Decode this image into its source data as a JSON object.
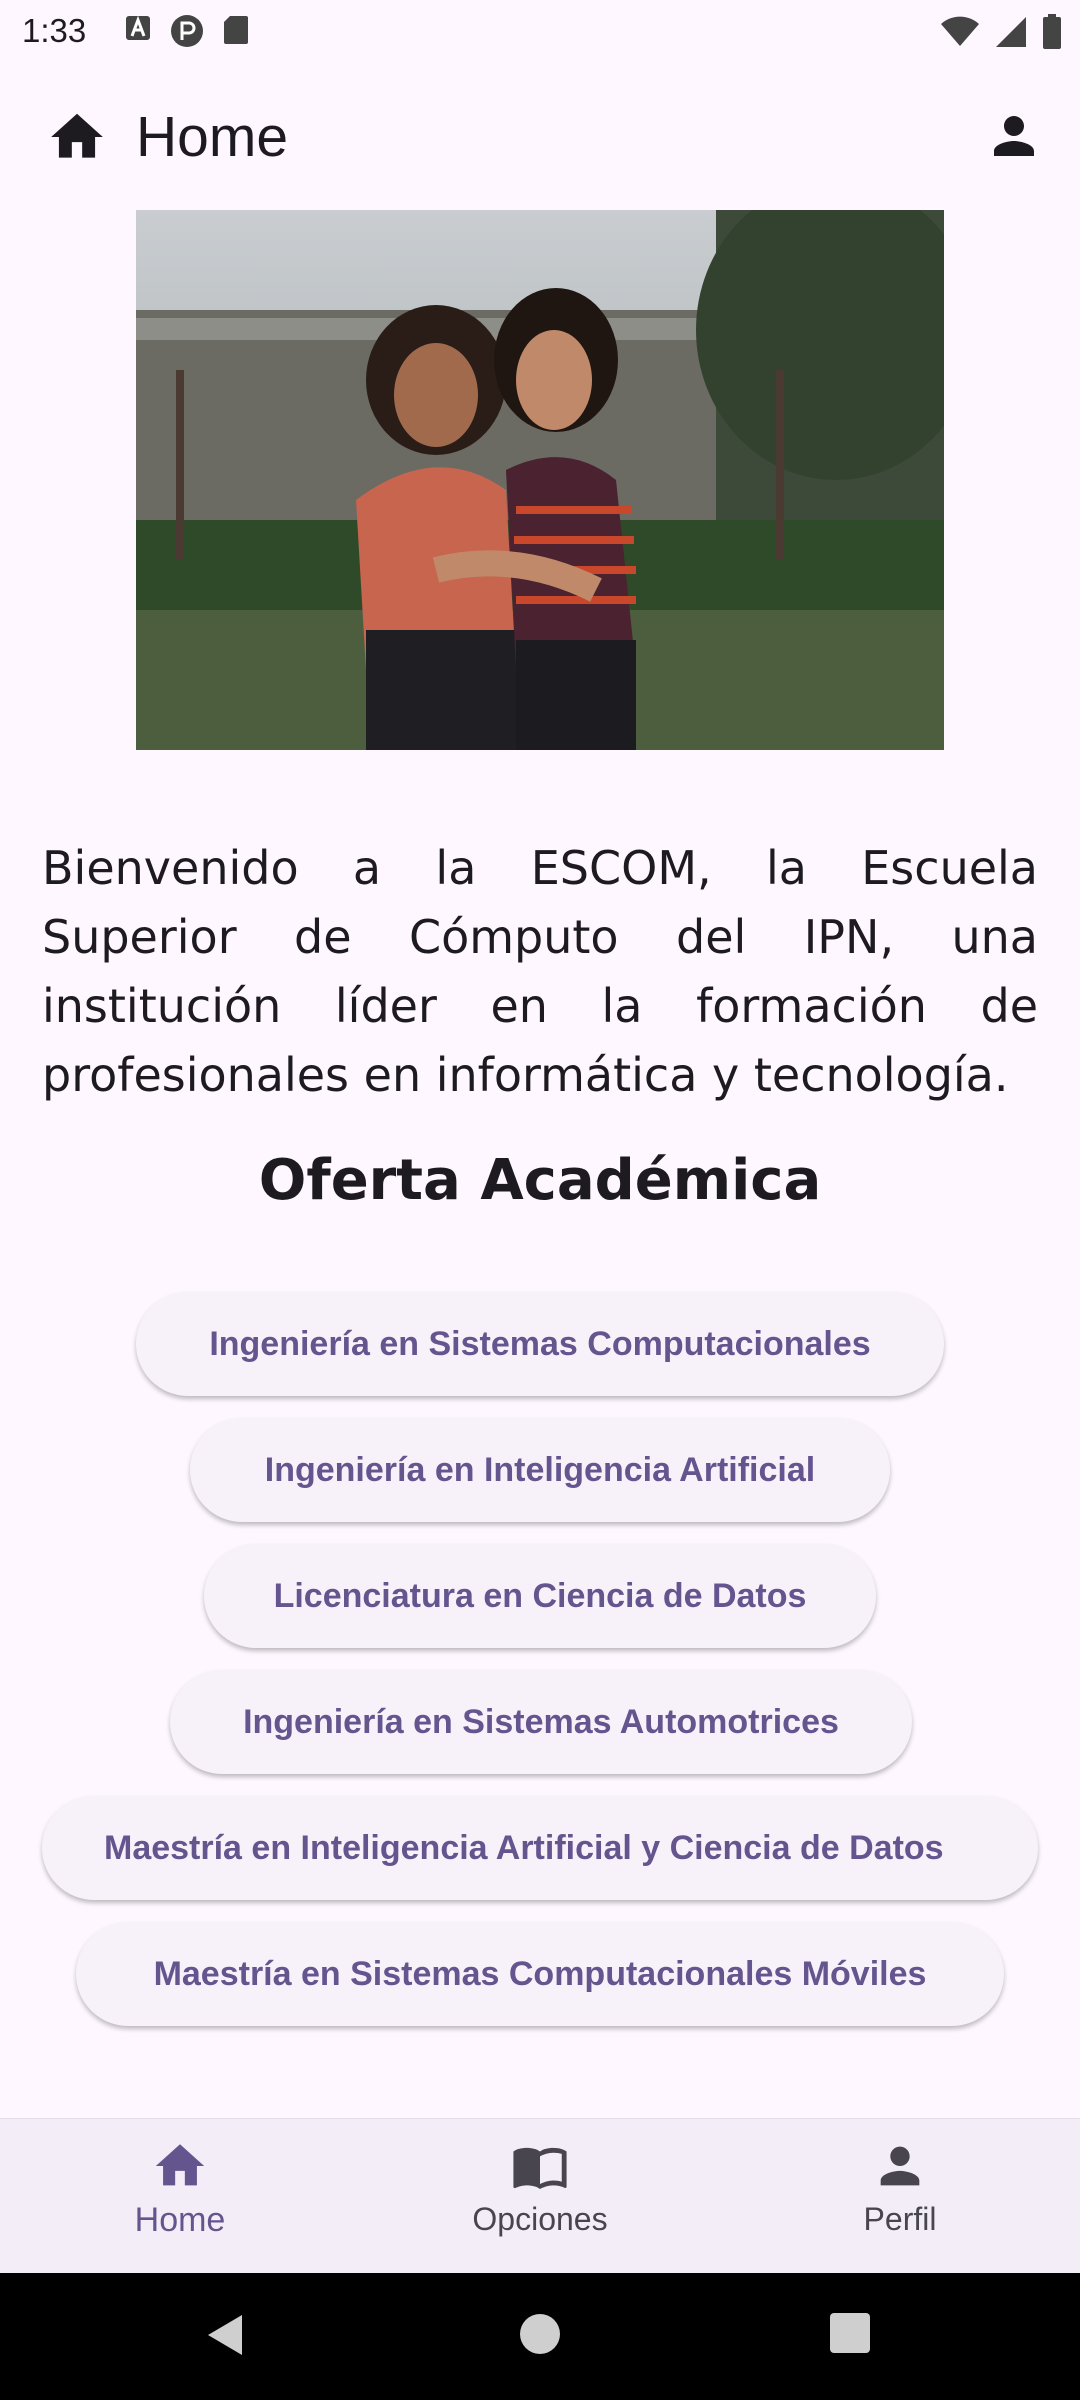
{
  "status_bar": {
    "time": "1:33",
    "icons": [
      "a-icon",
      "p-icon",
      "sd-card-icon",
      "wifi-icon",
      "signal-icon",
      "battery-icon"
    ]
  },
  "app_bar": {
    "title": "Home",
    "leading_icon": "home-icon",
    "trailing_icon": "account-icon"
  },
  "hero_image": {
    "description": "two-women-hugging-photo"
  },
  "intro": {
    "text": "Bienvenido a la ESCOM, la Escuela Superior de Cómputo del IPN, una institución líder en la formación de profesionales en informática y tecnología."
  },
  "section": {
    "title": "Oferta Académica"
  },
  "programs": [
    {
      "label": "Ingeniería en Sistemas Computacionales"
    },
    {
      "label": "Ingeniería en Inteligencia Artificial"
    },
    {
      "label": "Licenciatura en Ciencia de Datos"
    },
    {
      "label": "Ingeniería en Sistemas Automotrices"
    },
    {
      "label": "Maestría en Inteligencia Artificial y Ciencia de Datos"
    },
    {
      "label": "Maestría en Sistemas Computacionales Móviles"
    }
  ],
  "bottom_nav": {
    "items": [
      {
        "label": "Home",
        "icon": "home-icon",
        "active": true
      },
      {
        "label": "Opciones",
        "icon": "book-icon",
        "active": false
      },
      {
        "label": "Perfil",
        "icon": "person-icon",
        "active": false
      }
    ]
  },
  "colors": {
    "background": "#FEF7FF",
    "accent": "#65558F",
    "button_bg": "#F7F2FA",
    "nav_bg": "#F3EDF7"
  }
}
